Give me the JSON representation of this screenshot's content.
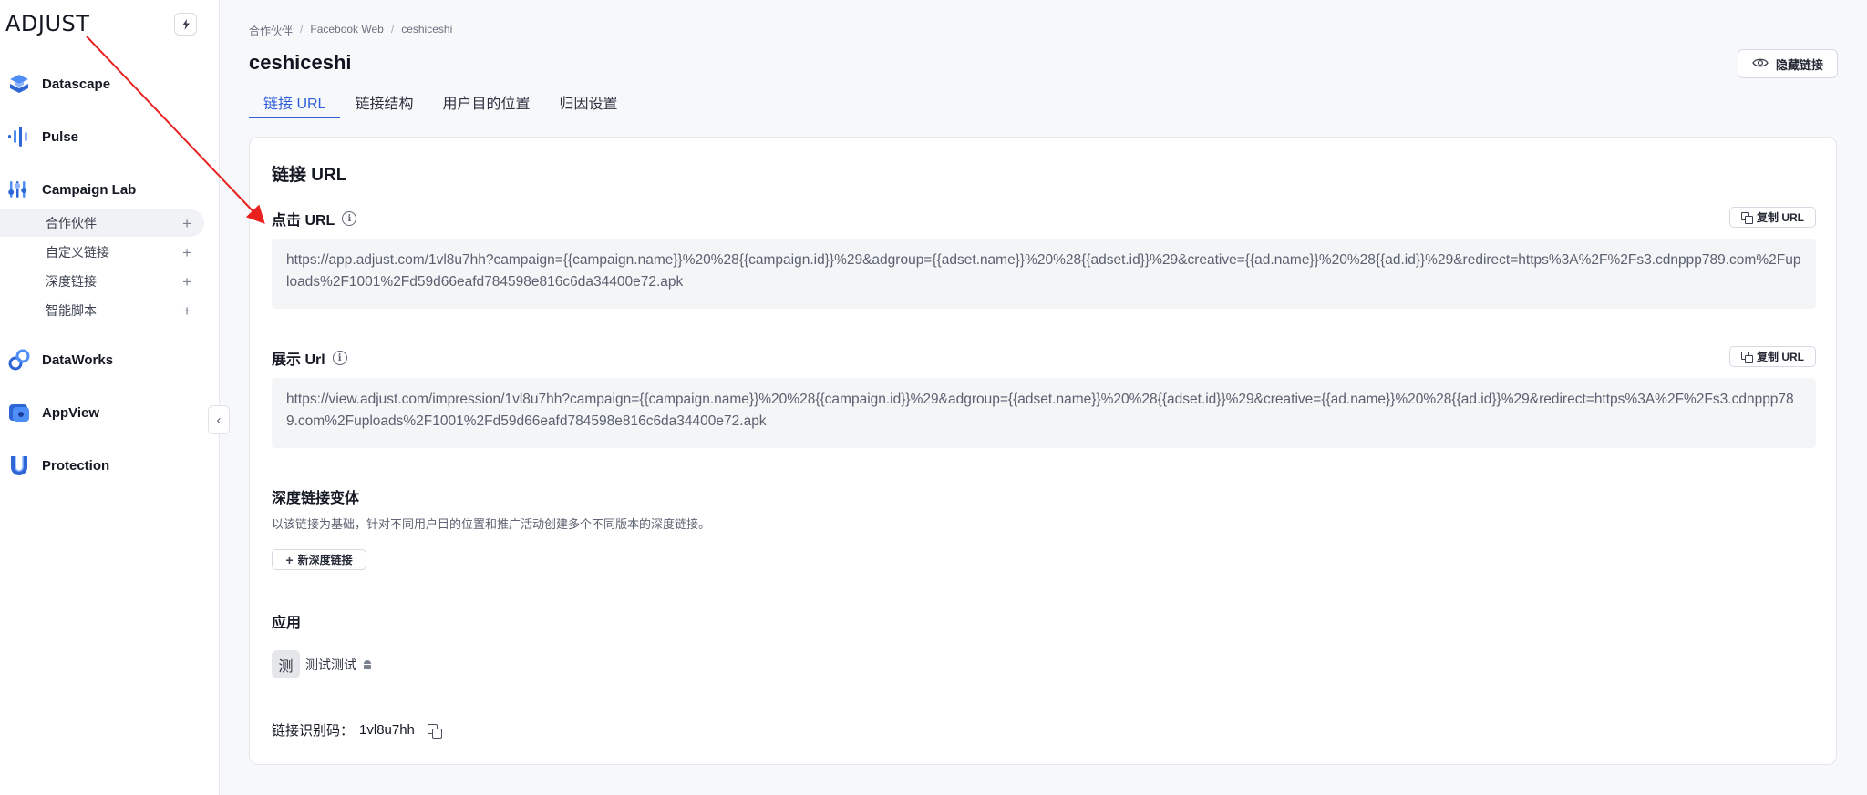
{
  "brand": {
    "logo_text": "ADJUST",
    "accent_color": "#2f5fd8"
  },
  "sidebar": {
    "bolt_icon": "bolt-icon",
    "items": [
      {
        "label": "Datascape",
        "icon": "datascape-icon"
      },
      {
        "label": "Pulse",
        "icon": "pulse-icon"
      },
      {
        "label": "Campaign Lab",
        "icon": "campaign-lab-icon"
      },
      {
        "label": "DataWorks",
        "icon": "dataworks-icon"
      },
      {
        "label": "AppView",
        "icon": "appview-icon"
      },
      {
        "label": "Protection",
        "icon": "protection-icon"
      }
    ],
    "campaign_lab_sub": [
      {
        "label": "合作伙伴",
        "active": true
      },
      {
        "label": "自定义链接",
        "active": false
      },
      {
        "label": "深度链接",
        "active": false
      },
      {
        "label": "智能脚本",
        "active": false
      }
    ],
    "collapse_icon": "‹"
  },
  "header": {
    "breadcrumb": [
      "合作伙伴",
      "Facebook Web",
      "ceshiceshi"
    ],
    "breadcrumb_sep": "/",
    "title": "ceshiceshi",
    "hide_link_label": "隐藏链接",
    "tabs": [
      {
        "label": "链接 URL",
        "active": true
      },
      {
        "label": "链接结构",
        "active": false
      },
      {
        "label": "用户目的位置",
        "active": false
      },
      {
        "label": "归因设置",
        "active": false
      }
    ]
  },
  "card": {
    "title": "链接 URL",
    "click_url": {
      "label": "点击 URL",
      "copy_label": "复制 URL",
      "value": "https://app.adjust.com/1vl8u7hh?campaign={{campaign.name}}%20%28{{campaign.id}}%29&adgroup={{adset.name}}%20%28{{adset.id}}%29&creative={{ad.name}}%20%28{{ad.id}}%29&redirect=https%3A%2F%2Fs3.cdnppp789.com%2Fuploads%2F1001%2Fd59d66eafd784598e816c6da34400e72.apk"
    },
    "impression_url": {
      "label": "展示 Url",
      "copy_label": "复制 URL",
      "value": "https://view.adjust.com/impression/1vl8u7hh?campaign={{campaign.name}}%20%28{{campaign.id}}%29&adgroup={{adset.name}}%20%28{{adset.id}}%29&creative={{ad.name}}%20%28{{ad.id}}%29&redirect=https%3A%2F%2Fs3.cdnppp789.com%2Fuploads%2F1001%2Fd59d66eafd784598e816c6da34400e72.apk"
    },
    "deeplink_variants": {
      "title": "深度链接变体",
      "description": "以该链接为基础，针对不同用户目的位置和推广活动创建多个不同版本的深度链接。",
      "new_button": "新深度链接"
    },
    "app": {
      "title": "应用",
      "avatar_text": "测",
      "name": "测试测试",
      "platform_icon": "android-icon"
    },
    "link_id": {
      "label": "链接识别码：",
      "value": "1vl8u7hh"
    }
  }
}
